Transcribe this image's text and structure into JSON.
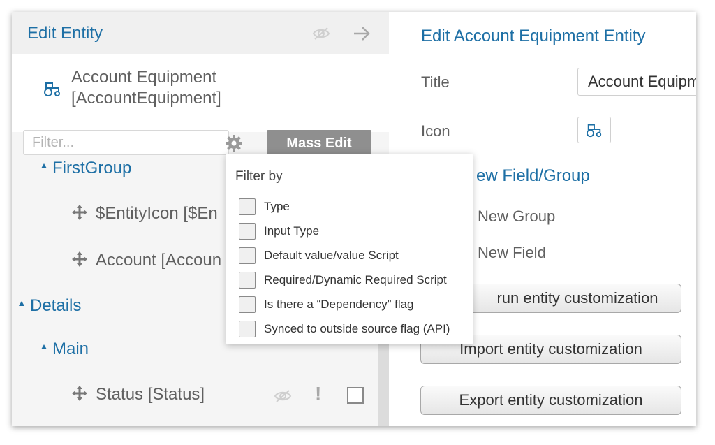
{
  "left_panel": {
    "title": "Edit Entity",
    "entity_name_line1": "Account Equipment",
    "entity_name_line2": "[AccountEquipment]",
    "filter_placeholder": "Filter...",
    "mass_edit_label": "Mass Edit",
    "tree": {
      "group1": "FirstGroup",
      "field1": "$EntityIcon [$En",
      "field2": "Account [Accoun",
      "group2": "Details",
      "subgroup": "Main",
      "field3": "Status [Status]",
      "field3_required_mark": "!"
    }
  },
  "right_panel": {
    "title": "Edit Account Equipment Entity",
    "title_label": "Title",
    "title_value": "Account Equipment",
    "icon_label": "Icon",
    "add_heading": "ew Field/Group",
    "new_group": "New Group",
    "new_field": "New Field",
    "buttons": {
      "rerun": "run entity customization",
      "import": "Import entity customization",
      "export": "Export entity customization"
    }
  },
  "filter_dropdown": {
    "title": "Filter by",
    "options": [
      {
        "label": "Type",
        "checked": false
      },
      {
        "label": "Input Type",
        "checked": false
      },
      {
        "label": "Default value/value Script",
        "checked": false
      },
      {
        "label": "Required/Dynamic Required Script",
        "checked": false
      },
      {
        "label": "Is there a “Dependency” flag",
        "checked": false
      },
      {
        "label": "Synced to outside source flag (API)",
        "checked": false
      }
    ]
  },
  "colors": {
    "accent": "#1d6fa5",
    "text": "#606060",
    "mass_edit_bg": "#8f8f8f"
  },
  "icons": [
    "eye-off-icon",
    "arrow-right-icon",
    "tractor-icon",
    "gear-icon",
    "move-icon",
    "exclamation-icon"
  ]
}
